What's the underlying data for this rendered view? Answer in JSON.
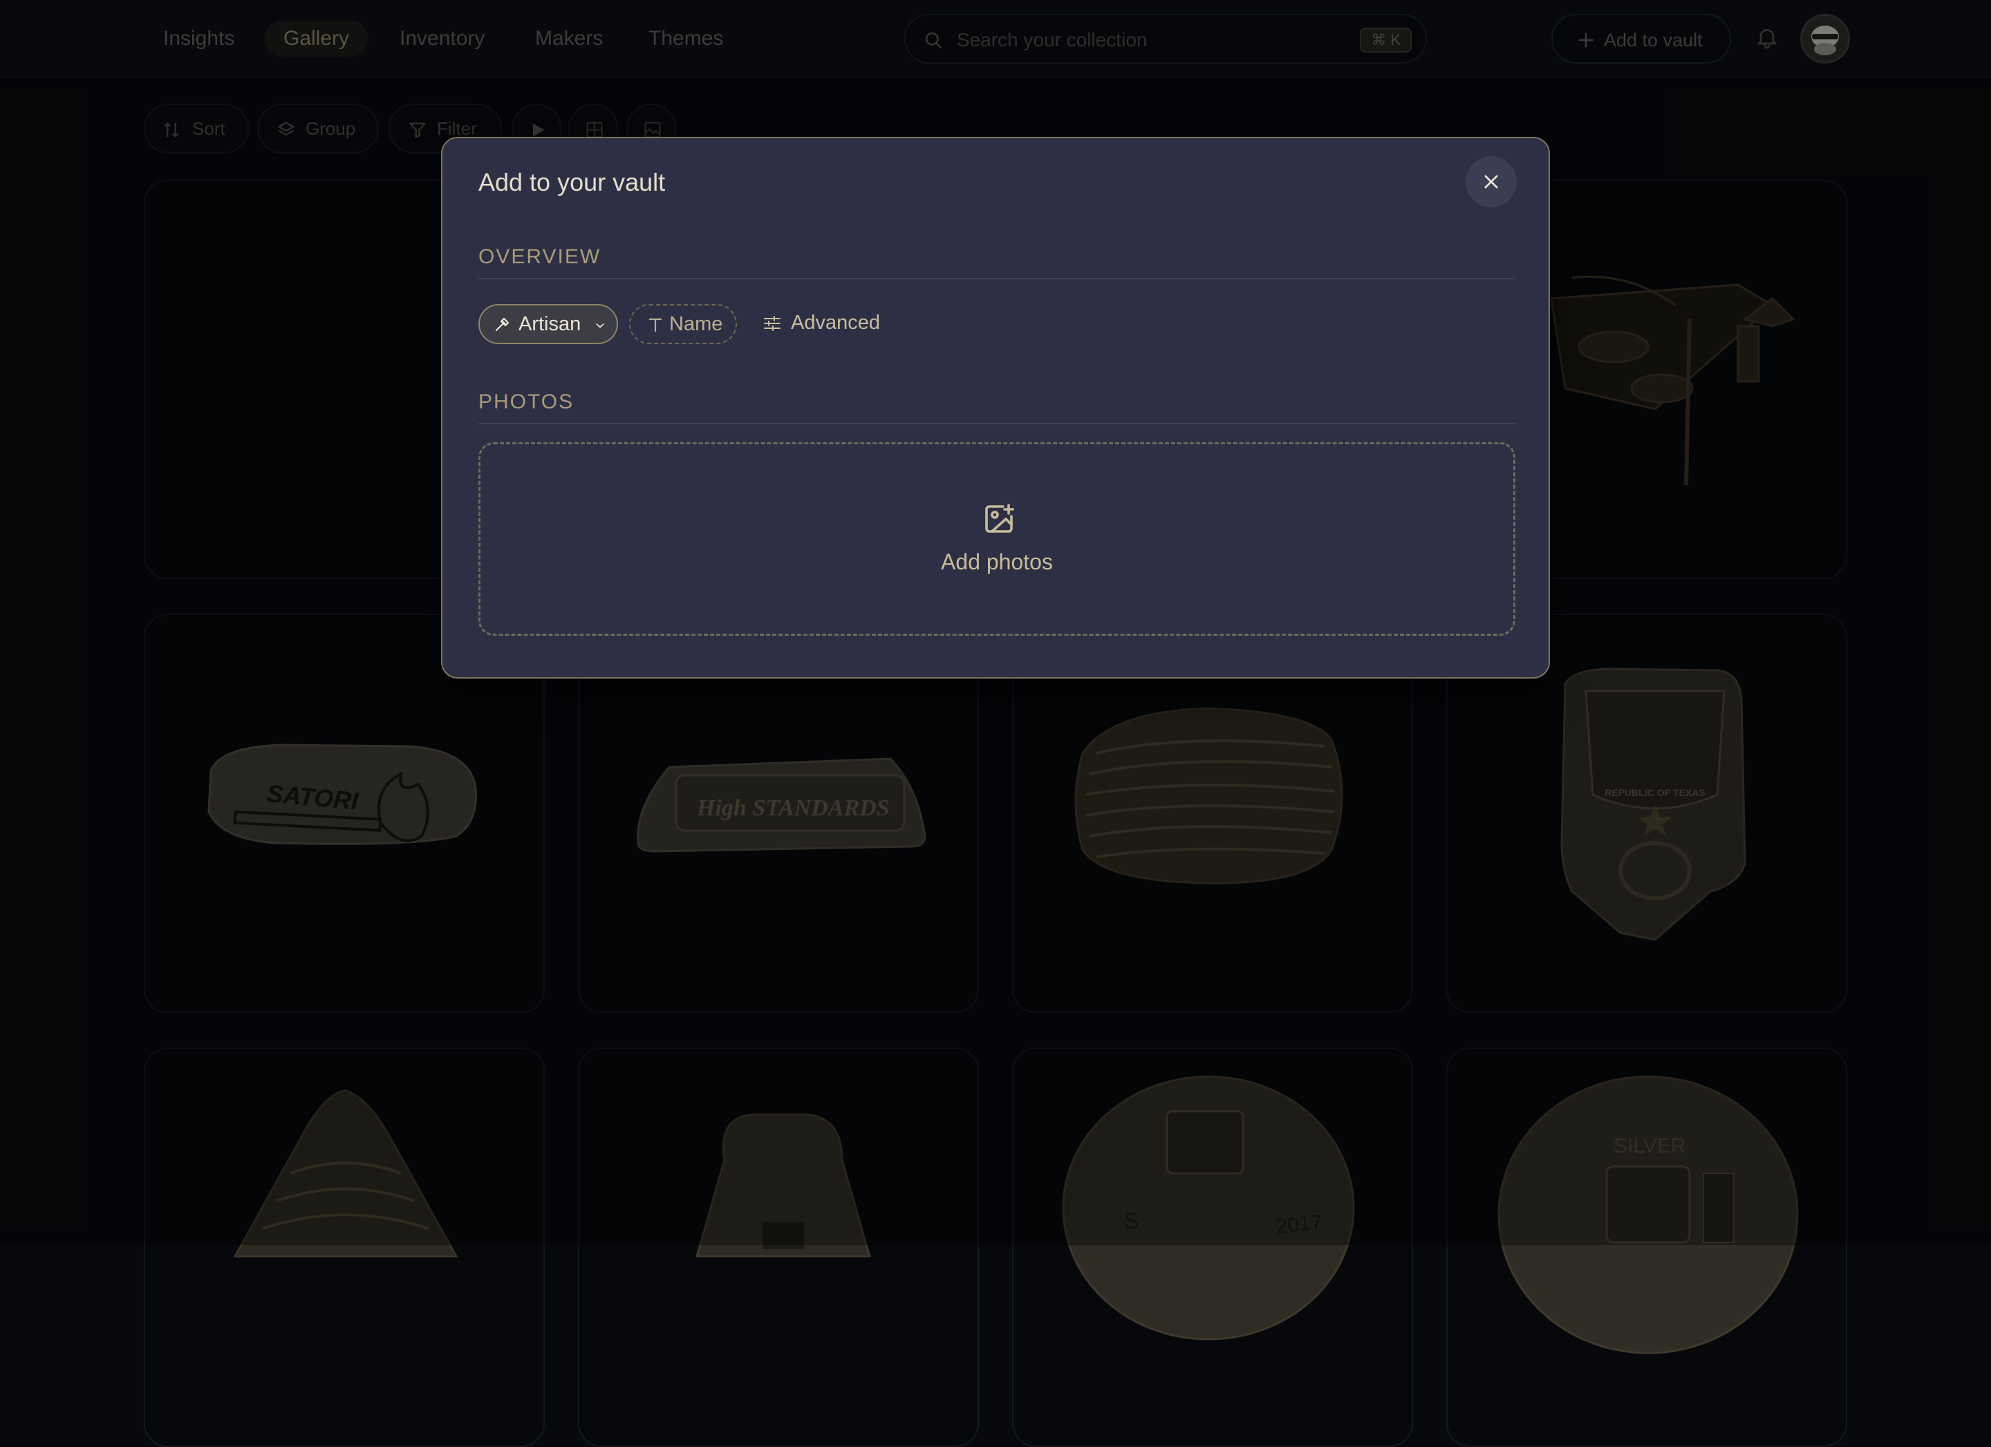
{
  "nav": {
    "tabs": [
      {
        "label": "Insights",
        "active": false
      },
      {
        "label": "Gallery",
        "active": true
      },
      {
        "label": "Inventory",
        "active": false
      },
      {
        "label": "Makers",
        "active": false
      },
      {
        "label": "Themes",
        "active": false
      }
    ],
    "search": {
      "placeholder": "Search your collection",
      "shortcut": "⌘ K"
    },
    "add_to_vault_label": "Add to vault"
  },
  "toolbar": {
    "sort_label": "Sort",
    "group_label": "Group",
    "filter_label": "Filter"
  },
  "gallery": {
    "items": [
      {
        "engraving": ""
      },
      {
        "engraving": ""
      },
      {
        "engraving": ""
      },
      {
        "engraving": ""
      },
      {
        "engraving": "SATORI"
      },
      {
        "engraving": "High STANDARDS"
      },
      {
        "engraving": ""
      },
      {
        "engraving": "REPUBLIC OF TEXAS"
      },
      {
        "engraving": ""
      },
      {
        "engraving": ""
      },
      {
        "engraving": "2017"
      },
      {
        "engraving": "SILVER"
      }
    ]
  },
  "modal": {
    "title": "Add to your vault",
    "overview_label": "OVERVIEW",
    "chips": {
      "artisan": "Artisan",
      "name": "Name",
      "advanced": "Advanced"
    },
    "photos_label": "PHOTOS",
    "add_photos_label": "Add photos"
  },
  "colors": {
    "modal_bg": "#2d3044",
    "modal_border": "#7c7358",
    "accent_gold": "#a99b78",
    "page_bg": "#07090d"
  }
}
